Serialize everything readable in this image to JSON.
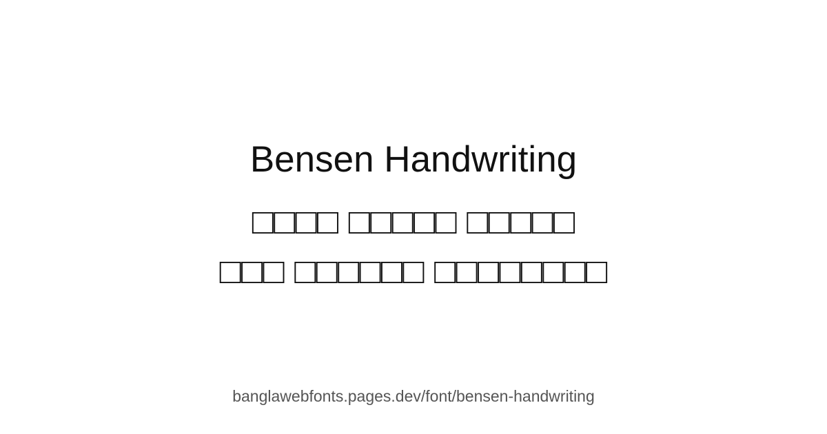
{
  "card": {
    "title": "Bensen Handwriting",
    "sample_lines": [
      "□□□□ □□□□□ □□□□□",
      "□□□ □□□□□□ □□□□□□□□"
    ],
    "url": "banglawebfonts.pages.dev/font/bensen-handwriting"
  },
  "colors": {
    "background": "#ffffff",
    "title_text": "#111111",
    "url_text": "#555555"
  }
}
